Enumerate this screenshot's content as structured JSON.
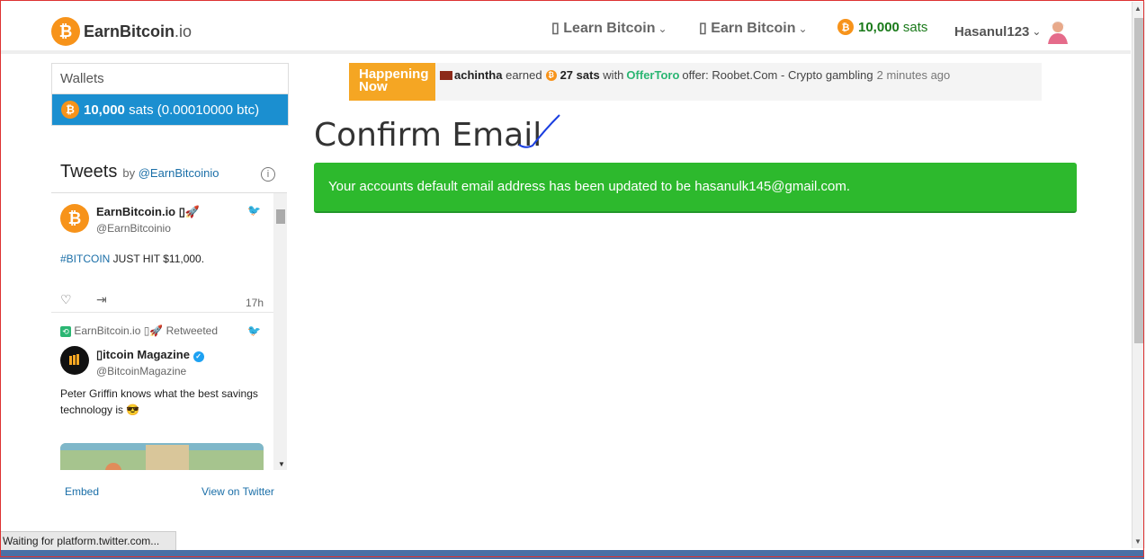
{
  "nav": {
    "brand_name": "EarnBitcoin",
    "brand_tld": ".io",
    "learn_label": "Learn Bitcoin",
    "earn_label": "Earn Bitcoin",
    "sats_amount": "10,000",
    "sats_unit": "sats",
    "username": "Hasanul123"
  },
  "sidebar": {
    "wallets_title": "Wallets",
    "wallet_amount": "10,000",
    "wallet_detail": "sats (0.00010000 btc)",
    "tweets_title": "Tweets",
    "tweets_by": "by",
    "tweets_handle": "@EarnBitcoinio",
    "embed_label": "Embed",
    "view_on_twitter_label": "View on Twitter",
    "tweets": [
      {
        "name": "EarnBitcoin.io",
        "handle": "@EarnBitcoinio",
        "hashtag": "#BITCOIN",
        "text": " JUST HIT $11,000.",
        "time": "17h"
      },
      {
        "retweet_label": "EarnBitcoin.io",
        "retweeted": "Retweeted",
        "name": "itcoin Magazine",
        "handle": "@BitcoinMagazine",
        "text": "Peter Griffin knows what the best savings technology is 😎"
      }
    ]
  },
  "banner": {
    "tag": "Happening Now",
    "user": "achintha",
    "earned": "earned",
    "sats": "27 sats",
    "with": "with",
    "offer_provider": "OfferToro",
    "offer_text": "offer: Roobet.Com - Crypto gambling",
    "time_ago": "2 minutes ago"
  },
  "main": {
    "title": "Confirm Email",
    "alert_text": "Your accounts default email address has been updated to be hasanulk145@gmail.com."
  },
  "browser": {
    "status_text": "Waiting for platform.twitter.com..."
  },
  "colors": {
    "bitcoin_orange": "#f7931a",
    "wallet_blue": "#1b8fd0",
    "success_green": "#2db92d",
    "banner_orange": "#f5a623"
  }
}
